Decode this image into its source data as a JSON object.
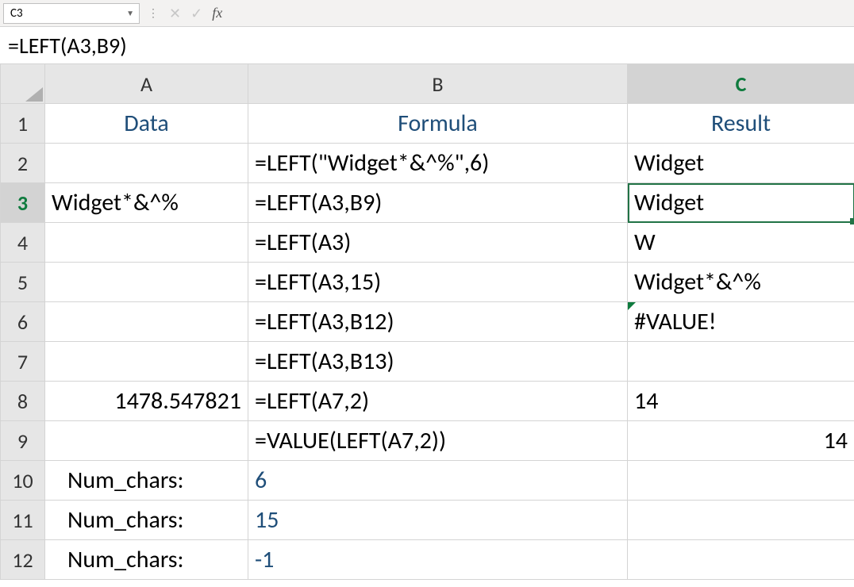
{
  "name_box": {
    "value": "C3"
  },
  "formula_bar": {
    "fx_label": "fx",
    "formula": "=LEFT(A3,B9)"
  },
  "columns": [
    "A",
    "B",
    "C"
  ],
  "row_numbers": [
    "1",
    "2",
    "3",
    "4",
    "5",
    "6",
    "7",
    "8",
    "9",
    "10",
    "11",
    "12"
  ],
  "active": {
    "row": "3",
    "col": "C",
    "cell_ref": "C3"
  },
  "rows": {
    "header": {
      "a": "Data",
      "b": "Formula",
      "c": "Result"
    },
    "r2": {
      "a": "",
      "b": "=LEFT(\"Widget*&^%\",6)",
      "c": "Widget"
    },
    "r3": {
      "a": "Widget*&^%",
      "b": "=LEFT(A3,B9)",
      "c": "Widget"
    },
    "r4": {
      "a": "",
      "b": "=LEFT(A3)",
      "c": "W"
    },
    "r5": {
      "a": "",
      "b": "=LEFT(A3,15)",
      "c": "Widget*&^%"
    },
    "r6": {
      "a": "",
      "b": "=LEFT(A3,B12)",
      "c": "#VALUE!"
    },
    "r7": {
      "a": "",
      "b": "=LEFT(A3,B13)",
      "c": ""
    },
    "r8": {
      "a": "1478.547821",
      "b": "=LEFT(A7,2)",
      "c": "14"
    },
    "r9": {
      "a": "",
      "b": "=VALUE(LEFT(A7,2))",
      "c": "14"
    },
    "r10": {
      "a": "Num_chars:",
      "b": "6",
      "c": ""
    },
    "r11": {
      "a": "Num_chars:",
      "b": "15",
      "c": ""
    },
    "r12": {
      "a": "Num_chars:",
      "b": "-1",
      "c": ""
    }
  }
}
